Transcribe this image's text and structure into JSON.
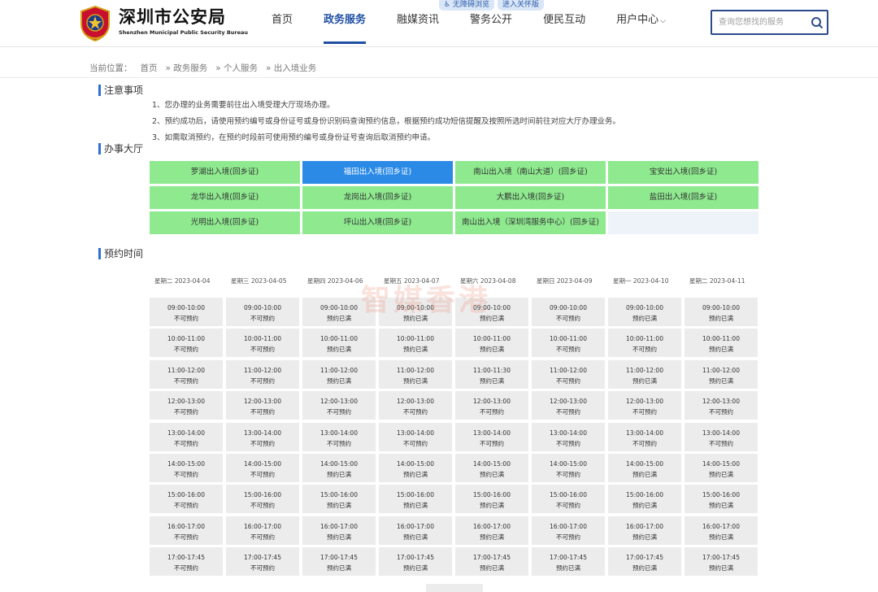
{
  "header": {
    "logo_cn": "深圳市公安局",
    "logo_en": "Shenzhen Municipal Public Security Bureau",
    "nav": [
      {
        "label": "首页",
        "active": false
      },
      {
        "label": "政务服务",
        "active": true
      },
      {
        "label": "融媒资讯",
        "active": false
      },
      {
        "label": "警务公开",
        "active": false
      },
      {
        "label": "便民互动",
        "active": false
      },
      {
        "label": "用户中心",
        "active": false,
        "dropdown": true
      }
    ],
    "access_links": [
      "无障碍浏览",
      "进入关怀版"
    ],
    "search_placeholder": "查询您想找的服务"
  },
  "breadcrumb": {
    "prefix": "当前位置：",
    "items": [
      "首页",
      "» 政务服务",
      "» 个人服务",
      "» 出入境业务"
    ]
  },
  "notes": {
    "title": "注意事项",
    "lines": [
      "1、您办理的业务需要前往出入境受理大厅现场办理。",
      "2、预约成功后，请使用预约编号或身份证号或身份识别码查询预约信息，根据预约成功短信提醒及按照所选时间前往对应大厅办理业务。",
      "3、如需取消预约，在预约时段前可使用预约编号或身份证号查询后取消预约申请。"
    ]
  },
  "halls": {
    "title": "办事大厅",
    "items": [
      {
        "label": "罗湖出入境(回乡证)",
        "selected": false
      },
      {
        "label": "福田出入境(回乡证)",
        "selected": true
      },
      {
        "label": "南山出入境（南山大道）(回乡证)",
        "selected": false
      },
      {
        "label": "宝安出入境(回乡证)",
        "selected": false
      },
      {
        "label": "龙华出入境(回乡证)",
        "selected": false
      },
      {
        "label": "龙岗出入境(回乡证)",
        "selected": false
      },
      {
        "label": "大鹏出入境(回乡证)",
        "selected": false
      },
      {
        "label": "盐田出入境(回乡证)",
        "selected": false
      },
      {
        "label": "光明出入境(回乡证)",
        "selected": false
      },
      {
        "label": "坪山出入境(回乡证)",
        "selected": false
      },
      {
        "label": "南山出入境（深圳湾服务中心）(回乡证)",
        "selected": false
      }
    ]
  },
  "schedule": {
    "title": "预约时间",
    "days": [
      "星期二 2023-04-04",
      "星期三 2023-04-05",
      "星期四 2023-04-06",
      "星期五 2023-04-07",
      "星期六 2023-04-08",
      "星期日 2023-04-09",
      "星期一 2023-04-10",
      "星期二 2023-04-11"
    ],
    "rows": [
      {
        "times": [
          "09:00-10:00",
          "09:00-10:00",
          "09:00-10:00",
          "09:00-10:00",
          "09:00-10:00",
          "09:00-10:00",
          "09:00-10:00",
          "09:00-10:00"
        ],
        "status": [
          "不可预约",
          "不可预约",
          "预约已满",
          "预约已满",
          "预约已满",
          "不可预约",
          "预约已满",
          "预约已满"
        ]
      },
      {
        "times": [
          "10:00-11:00",
          "10:00-11:00",
          "10:00-11:00",
          "10:00-11:00",
          "10:00-11:00",
          "10:00-11:00",
          "10:00-11:00",
          "10:00-11:00"
        ],
        "status": [
          "不可预约",
          "不可预约",
          "预约已满",
          "预约已满",
          "预约已满",
          "不可预约",
          "不可预约",
          "预约已满"
        ]
      },
      {
        "times": [
          "11:00-12:00",
          "11:00-12:00",
          "11:00-12:00",
          "11:00-12:00",
          "11:00-11:30",
          "11:00-12:00",
          "11:00-12:00",
          "11:00-12:00"
        ],
        "status": [
          "不可预约",
          "不可预约",
          "预约已满",
          "预约已满",
          "预约已满",
          "不可预约",
          "预约已满",
          "预约已满"
        ]
      },
      {
        "times": [
          "12:00-13:00",
          "12:00-13:00",
          "12:00-13:00",
          "12:00-13:00",
          "12:00-13:00",
          "12:00-13:00",
          "12:00-13:00",
          "12:00-13:00"
        ],
        "status": [
          "不可预约",
          "不可预约",
          "不可预约",
          "不可预约",
          "不可预约",
          "不可预约",
          "不可预约",
          "不可预约"
        ]
      },
      {
        "times": [
          "13:00-14:00",
          "13:00-14:00",
          "13:00-14:00",
          "13:00-14:00",
          "13:00-14:00",
          "13:00-14:00",
          "13:00-14:00",
          "13:00-14:00"
        ],
        "status": [
          "不可预约",
          "不可预约",
          "不可预约",
          "不可预约",
          "不可预约",
          "不可预约",
          "不可预约",
          "不可预约"
        ]
      },
      {
        "times": [
          "14:00-15:00",
          "14:00-15:00",
          "14:00-15:00",
          "14:00-15:00",
          "14:00-15:00",
          "14:00-15:00",
          "14:00-15:00",
          "14:00-15:00"
        ],
        "status": [
          "不可预约",
          "不可预约",
          "预约已满",
          "预约已满",
          "预约已满",
          "不可预约",
          "预约已满",
          "预约已满"
        ]
      },
      {
        "times": [
          "15:00-16:00",
          "15:00-16:00",
          "15:00-16:00",
          "15:00-16:00",
          "15:00-16:00",
          "15:00-16:00",
          "15:00-16:00",
          "15:00-16:00"
        ],
        "status": [
          "不可预约",
          "不可预约",
          "预约已满",
          "预约已满",
          "预约已满",
          "不可预约",
          "预约已满",
          "预约已满"
        ]
      },
      {
        "times": [
          "16:00-17:00",
          "16:00-17:00",
          "16:00-17:00",
          "16:00-17:00",
          "16:00-17:00",
          "16:00-17:00",
          "16:00-17:00",
          "16:00-17:00"
        ],
        "status": [
          "不可预约",
          "不可预约",
          "预约已满",
          "预约已满",
          "预约已满",
          "不可预约",
          "预约已满",
          "预约已满"
        ]
      },
      {
        "times": [
          "17:00-17:45",
          "17:00-17:45",
          "17:00-17:45",
          "17:00-17:45",
          "17:00-17:45",
          "17:00-17:45",
          "17:00-17:45",
          "17:00-17:45"
        ],
        "status": [
          "不可预约",
          "不可预约",
          "预约已满",
          "预约已满",
          "预约已满",
          "预约已满",
          "预约已满",
          "预约已满"
        ]
      }
    ]
  },
  "watermark": "智媒香港",
  "colors": {
    "primary": "#1f4fa3",
    "hall_default": "#8ee98f",
    "hall_selected": "#2b8ae6",
    "slot_bg": "#ececec",
    "section_bar": "#2e6fd1"
  }
}
